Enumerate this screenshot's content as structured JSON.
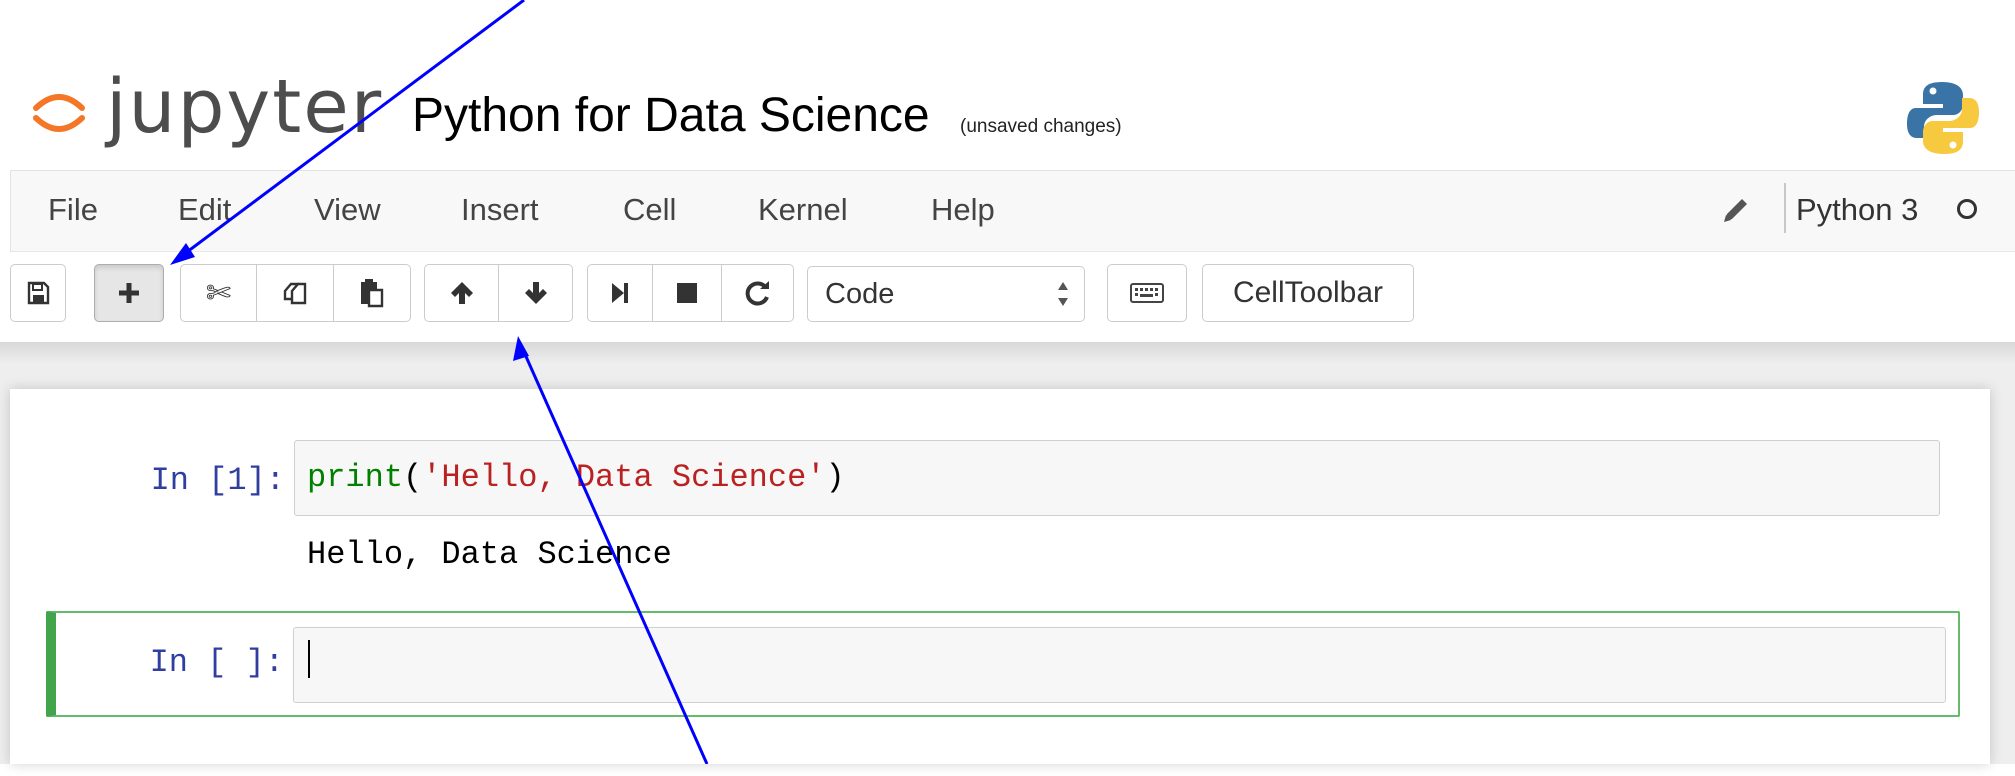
{
  "header": {
    "logo_text": "jupyter",
    "notebook_title": "Python for Data Science",
    "save_status": "(unsaved changes)",
    "kernel_logo": "python-logo"
  },
  "menubar": {
    "items": [
      {
        "label": "File"
      },
      {
        "label": "Edit"
      },
      {
        "label": "View"
      },
      {
        "label": "Insert"
      },
      {
        "label": "Cell"
      },
      {
        "label": "Kernel"
      },
      {
        "label": "Help"
      }
    ],
    "edit_icon": "pencil-icon",
    "kernel_name": "Python 3",
    "kernel_state": "idle"
  },
  "toolbar": {
    "buttons": [
      {
        "icon": "save-icon"
      },
      {
        "icon": "plus-icon",
        "active": true
      },
      {
        "icon": "scissors-icon"
      },
      {
        "icon": "copy-icon"
      },
      {
        "icon": "paste-icon"
      },
      {
        "icon": "arrow-up-icon"
      },
      {
        "icon": "arrow-down-icon"
      },
      {
        "icon": "step-forward-icon"
      },
      {
        "icon": "stop-icon"
      },
      {
        "icon": "restart-icon"
      },
      {
        "icon": "keyboard-icon"
      }
    ],
    "cell_type_selected": "Code",
    "celltoolbar_label": "CellToolbar"
  },
  "cells": [
    {
      "prompt": "In [1]:",
      "code": {
        "func": "print",
        "open": "(",
        "string": "'Hello, Data Science'",
        "close": ")"
      },
      "output": "Hello, Data Science"
    },
    {
      "prompt": "In [ ]:",
      "code_text": "",
      "selected": true
    }
  ],
  "colors": {
    "prompt": "#303f9f",
    "builtin": "#008000",
    "string": "#ba2121",
    "selected_cell_border": "#66bb6a",
    "annotation_arrow": "#0000ff"
  }
}
